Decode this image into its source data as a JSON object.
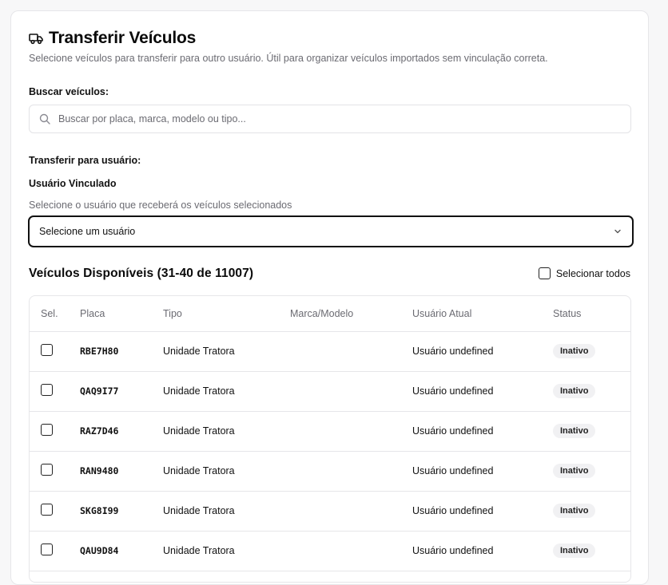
{
  "header": {
    "title": "Transferir Veículos",
    "subtitle": "Selecione veículos para transferir para outro usuário. Útil para organizar veículos importados sem vinculação correta.",
    "icon": "truck-icon"
  },
  "search": {
    "label": "Buscar veículos:",
    "placeholder": "Buscar por placa, marca, modelo ou tipo...",
    "value": ""
  },
  "transfer": {
    "label": "Transferir para usuário:",
    "field_label": "Usuário Vinculado",
    "hint": "Selecione o usuário que receberá os veículos selecionados",
    "selected_value": "Selecione um usuário"
  },
  "vehicles": {
    "section_title": "Veículos Disponíveis (31-40 de 11007)",
    "select_all_label": "Selecionar todos",
    "columns": {
      "sel": "Sel.",
      "placa": "Placa",
      "tipo": "Tipo",
      "marca": "Marca/Modelo",
      "usuario": "Usuário Atual",
      "status": "Status"
    },
    "rows": [
      {
        "placa": "RBE7H80",
        "tipo": "Unidade Tratora",
        "marca": "",
        "usuario": "Usuário undefined",
        "status": "Inativo"
      },
      {
        "placa": "QAQ9I77",
        "tipo": "Unidade Tratora",
        "marca": "",
        "usuario": "Usuário undefined",
        "status": "Inativo"
      },
      {
        "placa": "RAZ7D46",
        "tipo": "Unidade Tratora",
        "marca": "",
        "usuario": "Usuário undefined",
        "status": "Inativo"
      },
      {
        "placa": "RAN9480",
        "tipo": "Unidade Tratora",
        "marca": "",
        "usuario": "Usuário undefined",
        "status": "Inativo"
      },
      {
        "placa": "SKG8I99",
        "tipo": "Unidade Tratora",
        "marca": "",
        "usuario": "Usuário undefined",
        "status": "Inativo"
      },
      {
        "placa": "QAU9D84",
        "tipo": "Unidade Tratora",
        "marca": "",
        "usuario": "Usuário undefined",
        "status": "Inativo"
      }
    ]
  },
  "colors": {
    "background": "#f7f7f8",
    "card": "#ffffff",
    "border": "#e6e6e9",
    "muted_text": "#6b6b72",
    "badge_bg": "#f1f1f3"
  }
}
